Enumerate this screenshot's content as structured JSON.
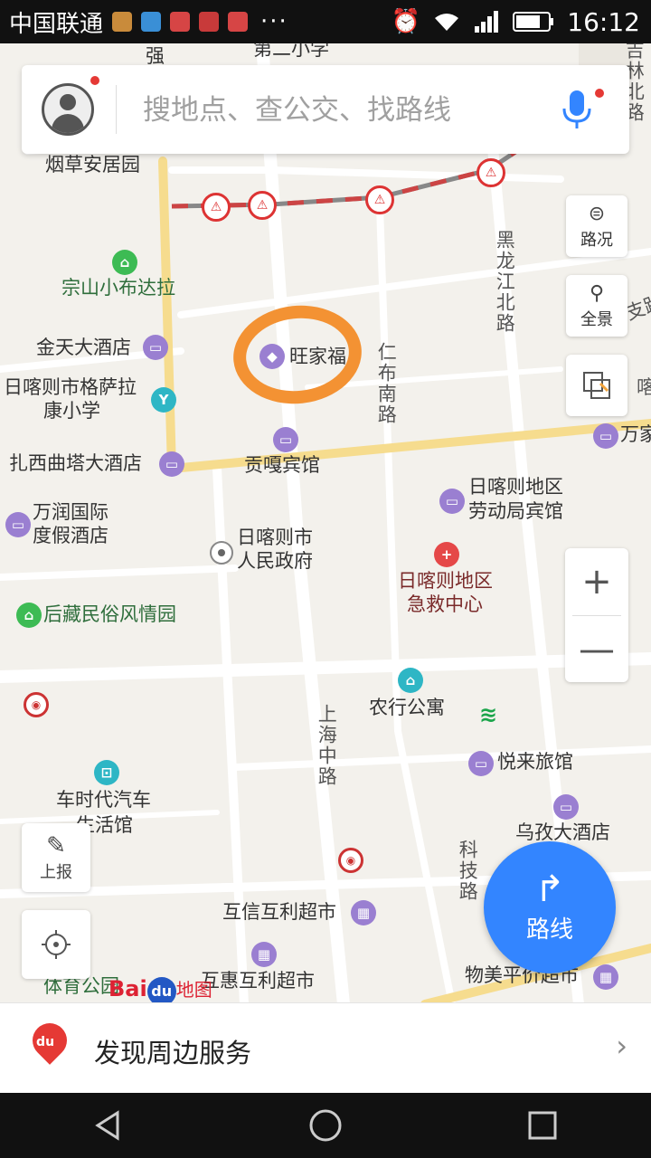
{
  "status_bar": {
    "carrier": "中国联通",
    "dots": "···",
    "time": "16:12",
    "icons": [
      "alarm-icon",
      "wifi-icon",
      "signal-icon",
      "battery-icon"
    ]
  },
  "search": {
    "placeholder": "搜地点、查公交、找路线"
  },
  "map_labels": {
    "qiang": "强",
    "di_er_xiaoxue": "第二小学",
    "yancao": "烟草安居园",
    "zongshan": "宗山小布达拉",
    "jintian": "金天大酒店",
    "gesala_1": "日喀则市格萨拉",
    "gesala_2": "康小学",
    "wangjiafu": "旺家福",
    "renbu": "仁布南路",
    "heilongjiang": "黑龙江北路",
    "zhaxi": "扎西曲塔大酒店",
    "gongga": "贡嘎宾馆",
    "wanrun_1": "万润国际",
    "wanrun_2": "度假酒店",
    "zhengfu_1": "日喀则市",
    "zhengfu_2": "人民政府",
    "laodong_1": "日喀则地区",
    "laodong_2": "劳动局宾馆",
    "jijiu_1": "日喀则地区",
    "jijiu_2": "急救中心",
    "houzang": "后藏民俗风情园",
    "nonghang": "农行公寓",
    "shanghai": "上海中路",
    "yuelai": "悦来旅馆",
    "cheshidai_1": "车时代汽车",
    "cheshidai_2": "生活馆",
    "wuzi": "乌孜大酒店",
    "keji": "科技路",
    "huxin": "互信互利超市",
    "huhui": "互惠互利超市",
    "wumei": "物美平价超市",
    "tiyu": "体育公园",
    "wanjia": "万家",
    "jilin": "吉林北路",
    "zhi": "支路",
    "ka": "喀则路"
  },
  "controls": {
    "traffic": "路况",
    "panorama": "全景",
    "zoom_in": "+",
    "zoom_out": "—",
    "report": "上报",
    "route": "路线"
  },
  "logo": {
    "bai": "Bai",
    "du": "du",
    "ditu": "地图"
  },
  "discover": {
    "text": "发现周边服务",
    "pin": "du"
  }
}
